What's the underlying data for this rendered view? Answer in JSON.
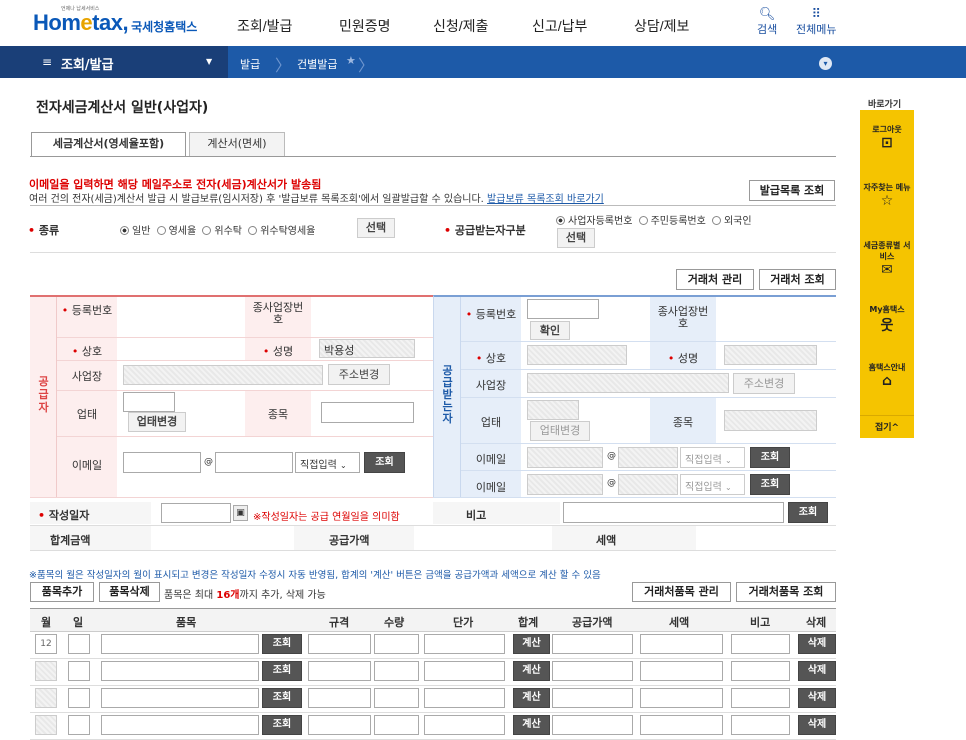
{
  "header": {
    "logo_text": "Hometax,",
    "logo_sub": "국세청홈택스",
    "logo_tiny": "언제나 납세서비스",
    "nav": [
      "조회/발급",
      "민원증명",
      "신청/제출",
      "신고/납부",
      "상담/제보"
    ],
    "search_label": "검색",
    "menu_label": "전체메뉴"
  },
  "navbar": {
    "menu": "조회/발급",
    "crumb1": "발급",
    "crumb2": "건별발급"
  },
  "page": {
    "title": "전자세금계산서 일반(사업자)",
    "tabs": [
      "세금계산서(영세율포함)",
      "계산서(면세)"
    ],
    "notice_red": "이메일을 입력하면 해당 메일주소로 전자(세금)계산서가 발송됨",
    "notice_line": "여러 건의 전자(세금)계산서 발급 시 발급보류(임시저장) 후 '발급보류 목록조회'에서 일괄발급할 수 있습니다.",
    "notice_link": "발급보류 목록조회 바로가기",
    "issue_list_btn": "발급목록 조회"
  },
  "type_row": {
    "label": "종류",
    "options": [
      "일반",
      "영세율",
      "위수탁",
      "위수탁영세율"
    ],
    "select_btn": "선택",
    "recv_label": "공급받는자구분",
    "recv_options": [
      "사업자등록번호",
      "주민등록번호",
      "외국인"
    ],
    "recv_select_btn": "선택"
  },
  "partner_btns": [
    "거래처 관리",
    "거래처 조회"
  ],
  "supplier": {
    "side": "공급자",
    "reg_label": "등록번호",
    "subbiz_label": "종사업장번호",
    "name_label": "상호",
    "rep_label": "성명",
    "rep_value": "박용성",
    "addr_label": "사업장",
    "addr_btn": "주소변경",
    "biz_label": "업태",
    "biz_btn": "업태변경",
    "item_label": "종목",
    "email_label": "이메일",
    "email_at": "@",
    "email_select": "직접입력",
    "email_btn": "조회"
  },
  "receiver": {
    "side": "공급받는자",
    "reg_label": "등록번호",
    "confirm_btn": "확인",
    "subbiz_label": "종사업장번호",
    "name_label": "상호",
    "rep_label": "성명",
    "addr_label": "사업장",
    "addr_btn": "주소변경",
    "biz_label": "업태",
    "biz_btn": "업태변경",
    "item_label": "종목",
    "email1_label": "이메일",
    "email2_label": "이메일",
    "email_at": "@",
    "email_select": "직접입력",
    "email_btn": "조회"
  },
  "write_row": {
    "label": "작성일자",
    "note": "※작성일자는 공급 연월일을 의미함",
    "note_mark": "▣",
    "remark_label": "비고",
    "remark_btn": "조회"
  },
  "sum_row": {
    "total": "합계금액",
    "supply": "공급가액",
    "tax": "세액"
  },
  "items": {
    "notice": "※품목의 월은 작성일자의 월이 표시되고 변경은 작성일자 수정시 자동 반영됨, 합계의 '계산' 버튼은 금액을 공급가액과 세액으로 계산 할 수 있음",
    "add_btn": "품목추가",
    "del_btn": "품목삭제",
    "limit_pre": "품목은 최대",
    "limit_num": "16개",
    "limit_post": "까지 추가, 삭제 가능",
    "mgmt_btn": "거래처품목 관리",
    "query_btn": "거래처품목 조회",
    "columns": [
      "월",
      "일",
      "품목",
      "규격",
      "수량",
      "단가",
      "합계",
      "공급가액",
      "세액",
      "비고",
      "삭제"
    ],
    "row_month": "12",
    "row_query": "조회",
    "row_calc": "계산",
    "row_delete": "삭제"
  },
  "rail": {
    "title": "바로가기",
    "items": [
      "로그아웃",
      "자주찾는 메뉴",
      "세금종류별 서비스",
      "My홈택스",
      "홈택스안내",
      "접기^"
    ]
  },
  "colors": {
    "accent": "#1d5aa8",
    "supplier_bg": "#fdeeee",
    "receiver_bg": "#e6eef9",
    "rail": "#f5c400"
  }
}
